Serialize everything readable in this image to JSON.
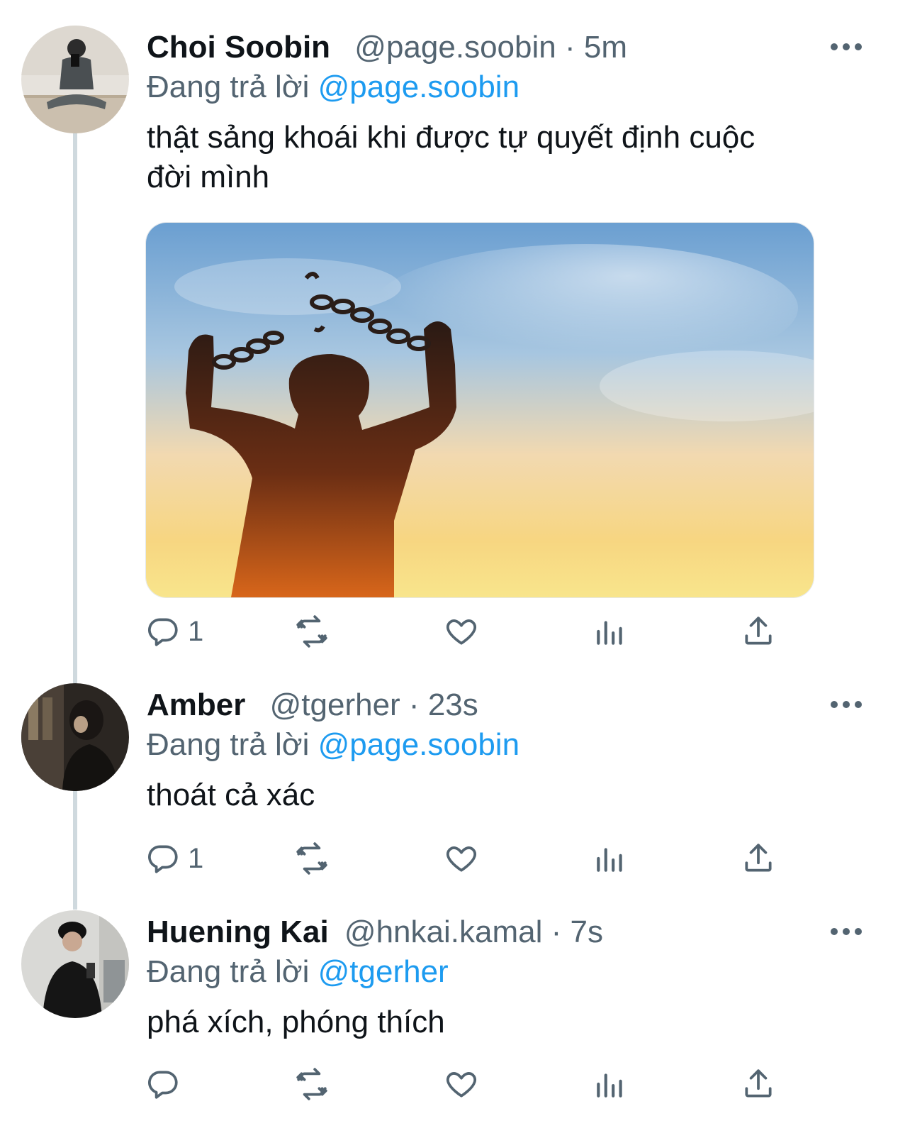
{
  "tweets": [
    {
      "name": "Choi Soobin",
      "handle": "@page.soobin",
      "separator": "·",
      "time": "5m",
      "replying_prefix": "Đang trả lời",
      "replying_to": "@page.soobin",
      "text_line1": "thật sảng khoái khi được tự quyết định cuộc",
      "text_line2": "đời mình",
      "reply_count": "1",
      "media_description": "photo"
    },
    {
      "name": "Amber",
      "handle": "@tgerher",
      "separator": "·",
      "time": "23s",
      "replying_prefix": "Đang trả lời",
      "replying_to": "@page.soobin",
      "text_line1": "thoát cả xác",
      "reply_count": "1"
    },
    {
      "name": "Huening Kai",
      "handle": "@hnkai.kamal",
      "separator": "·",
      "time": "7s",
      "replying_prefix": "Đang trả lời",
      "replying_to": "@tgerher",
      "text_line1": "phá xích, phóng thích",
      "reply_count": ""
    }
  ],
  "icons": {
    "reply": "reply-icon",
    "retweet": "retweet-icon",
    "like": "heart-icon",
    "views": "analytics-icon",
    "share": "share-icon",
    "more": "more-icon"
  },
  "colors": {
    "text": "#0f1419",
    "secondary": "#536471",
    "mention": "#1d9bf0",
    "thread_line": "#cfd9de"
  }
}
